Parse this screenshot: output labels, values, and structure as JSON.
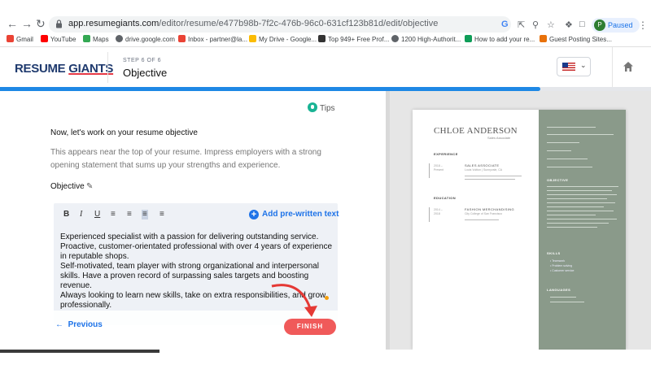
{
  "browser": {
    "url_host": "app.resumegiants.com",
    "url_path": "/editor/resume/e477b98b-7f2c-476b-96c0-631cf123b81d/edit/objective",
    "profile_initial": "P",
    "profile_status": "Paused",
    "bookmarks": [
      {
        "label": "Gmail",
        "color": "#ea4335"
      },
      {
        "label": "YouTube",
        "color": "#ff0000"
      },
      {
        "label": "Maps",
        "color": "#34a853"
      },
      {
        "label": "drive.google.com",
        "color": "#5f6368"
      },
      {
        "label": "Inbox - partner@la...",
        "color": "#ea4335"
      },
      {
        "label": "My Drive - Google...",
        "color": "#fbbc04"
      },
      {
        "label": "Top 949+ Free Prof...",
        "color": "#333333"
      },
      {
        "label": "1200 High-Authorit...",
        "color": "#5f6368"
      },
      {
        "label": "How to add your re...",
        "color": "#0f9d58"
      },
      {
        "label": "Guest Posting Sites...",
        "color": "#e8710a"
      }
    ]
  },
  "header": {
    "logo_part1": "RESUME ",
    "logo_part2": "GIANTS",
    "step_label": "STEP 6 OF 6",
    "title": "Objective"
  },
  "progress": {
    "fraction": 0.83
  },
  "editor_panel": {
    "tips_label": "Tips",
    "heading": "Now, let's work on your resume objective",
    "description": "This appears near the top of your resume. Impress employers with a strong opening statement that sums up your strengths and experience.",
    "objective_label": "Objective",
    "add_prewritten_label": "Add pre-written text",
    "toolbar": [
      "B",
      "I",
      "U",
      "☰",
      "≡",
      "≣",
      "≣"
    ],
    "text": "Experienced specialist with a passion for delivering outstanding service. Proactive, customer-orientated professional with over 4 years of experience in reputable shops.\nSelf-motivated, team player with strong organizational and interpersonal skills. Have a proven record of surpassing sales targets and boosting revenue.\nAlways looking to learn new skills, take on extra responsibilities, and grow professionally.",
    "previous_label": "Previous",
    "finish_label": "FINISH"
  },
  "resume_preview": {
    "name": "CHLOE ANDERSON",
    "role": "Sales Associate",
    "sections": {
      "experience": "EXPERIENCE",
      "education": "EDUCATION",
      "objective": "OBJECTIVE",
      "skills": "SKILLS",
      "languages": "LANGUAGES"
    },
    "job_title": "SALES ASSOCIATE",
    "job_company": "Louis Vuitton | Sunnyvale, CA",
    "edu_title": "FASHION MERCHANDISING",
    "edu_school": "City College of San Francisco",
    "skills": [
      "Teamwork",
      "Problem solving",
      "Customer service"
    ]
  },
  "colors": {
    "brand_navy": "#1f3a6e",
    "accent_red": "#f05a5a",
    "link_blue": "#1e73e8",
    "resume_sidebar": "#8a9a8a"
  }
}
